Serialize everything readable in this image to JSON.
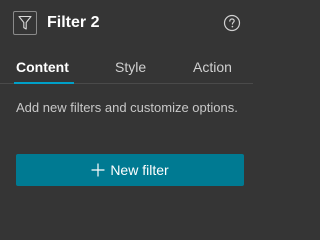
{
  "header": {
    "title": "Filter 2",
    "widget_icon": "filter-funnel-icon",
    "help_icon": "question-circle-icon"
  },
  "tabs": [
    {
      "label": "Content",
      "active": true
    },
    {
      "label": "Style",
      "active": false
    },
    {
      "label": "Action",
      "active": false
    }
  ],
  "content": {
    "description": "Add new filters and customize options.",
    "new_filter_button": {
      "label": "New filter",
      "icon": "plus-icon"
    }
  },
  "colors": {
    "background": "#353535",
    "accent": "#00a0c8",
    "button": "#007a92",
    "text": "#ffffff"
  }
}
